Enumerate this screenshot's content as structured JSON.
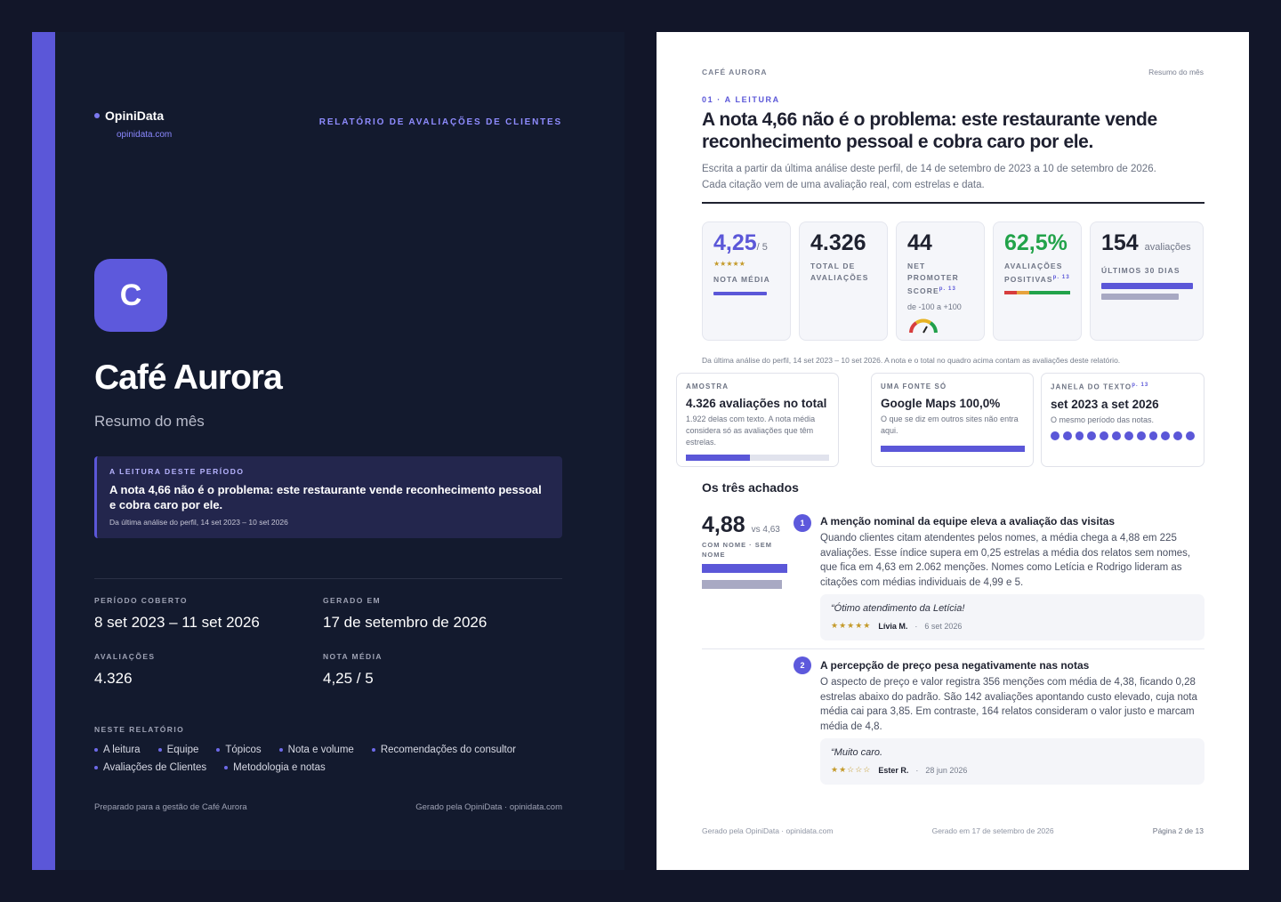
{
  "cover": {
    "brand": "OpiniData",
    "brand_url": "opinidata.com",
    "report_kicker": "RELATÓRIO DE AVALIAÇÕES DE CLIENTES",
    "logo_letter": "C",
    "title": "Café Aurora",
    "subtitle": "Resumo do mês",
    "reading": {
      "kicker": "A LEITURA DESTE PERÍODO",
      "text": "A nota 4,66 não é o problema: este restaurante vende reconhecimento pessoal e cobra caro por ele.",
      "meta": "Da última análise do perfil, 14 set 2023 – 10 set 2026"
    },
    "stats": [
      {
        "label": "PERÍODO COBERTO",
        "value": "8 set 2023 – 11 set 2026"
      },
      {
        "label": "GERADO EM",
        "value": "17 de setembro de 2026"
      },
      {
        "label": "AVALIAÇÕES",
        "value": "4.326"
      },
      {
        "label": "NOTA MÉDIA",
        "value": "4,25 / 5"
      }
    ],
    "in_report": {
      "kicker": "NESTE RELATÓRIO",
      "items": [
        "A leitura",
        "Equipe",
        "Tópicos",
        "Nota e volume",
        "Recomendações do consultor",
        "Avaliações de Clientes",
        "Metodologia e notas"
      ]
    },
    "footer_left": "Preparado para a gestão de Café Aurora",
    "footer_right": "Gerado pela OpiniData · opinidata.com"
  },
  "page": {
    "header_left": "CAFÉ AURORA",
    "header_right": "Resumo do mês",
    "section_kicker": "01 · A LEITURA",
    "title": "A nota 4,66 não é o problema: este restaurante vende reconhecimento pessoal e cobra caro por ele.",
    "lede": "Escrita a partir da última análise deste perfil, de 14 de setembro de 2023 a 10 de setembro de 2026. Cada citação vem de uma avaliação real, com estrelas e data.",
    "kpis": [
      {
        "value": "4,25",
        "suffix": "/ 5",
        "label": "NOTA MÉDIA",
        "stars": "★★★★★"
      },
      {
        "value": "4.326",
        "label": "TOTAL DE AVALIAÇÕES"
      },
      {
        "value": "44",
        "label": "NET PROMOTER SCORE",
        "sup": "p. 13",
        "sub": "de -100 a +100"
      },
      {
        "value": "62,5%",
        "label": "AVALIAÇÕES POSITIVAS",
        "sup": "p. 13"
      },
      {
        "value": "154",
        "suffix": "avaliações",
        "label": "ÚLTIMOS 30 DIAS"
      }
    ],
    "kpi_note": "Da última análise do perfil, 14 set 2023 – 10 set 2026. A nota e o total no quadro acima contam as avaliações deste relatório.",
    "sources": [
      {
        "kicker": "AMOSTRA",
        "heading": "4.326 avaliações no total",
        "desc": "1.922 delas com texto. A nota média considera só as avaliações que têm estrelas."
      },
      {
        "kicker": "UMA FONTE SÓ",
        "heading": "Google Maps 100,0%",
        "desc": "O que se diz em outros sites não entra aqui."
      },
      {
        "kicker": "JANELA DO TEXTO",
        "sup": "p. 13",
        "heading": "set 2023 a set 2026",
        "desc": "O mesmo período das notas."
      }
    ],
    "findings_title": "Os três achados",
    "findings": [
      {
        "number": "1",
        "big": "4,88",
        "vs": "vs 4,63",
        "label": "COM NOME · SEM NOME",
        "title": "A menção nominal da equipe eleva a avaliação das visitas",
        "text": "Quando clientes citam atendentes pelos nomes, a média chega a 4,88 em 225 avaliações. Esse índice supera em 0,25 estrelas a média dos relatos sem nomes, que fica em 4,63 em 2.062 menções. Nomes como Letícia e Rodrigo lideram as citações com médias individuais de 4,99 e 5.",
        "quote": "“Ótimo atendimento da Letícia!",
        "stars": "★★★★★",
        "author": "Lívia M.",
        "date": "6 set 2026"
      },
      {
        "number": "2",
        "title": "A percepção de preço pesa negativamente nas notas",
        "text": "O aspecto de preço e valor registra 356 menções com média de 4,38, ficando 0,28 estrelas abaixo do padrão. São 142 avaliações apontando custo elevado, cuja nota média cai para 3,85. Em contraste, 164 relatos consideram o valor justo e marcam média de 4,8.",
        "quote": "“Muito caro.",
        "stars": "★★☆☆☆",
        "author": "Ester R.",
        "date": "28 jun 2026"
      }
    ],
    "footer_left": "Gerado pela OpiniData · opinidata.com",
    "footer_mid": "Gerado em 17 de setembro de 2026",
    "footer_right": "Página 2 de 13"
  },
  "colors": {
    "accent": "#5b57d8",
    "green": "#22a34a",
    "gold": "#c49a2a"
  }
}
